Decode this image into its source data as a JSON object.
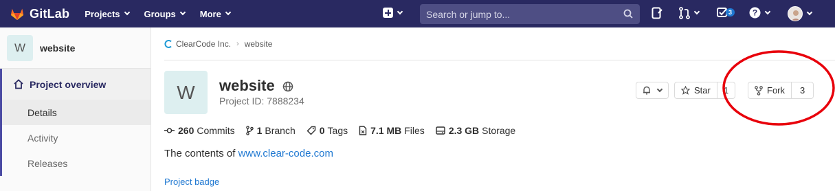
{
  "navbar": {
    "brand": "GitLab",
    "menu": [
      {
        "label": "Projects"
      },
      {
        "label": "Groups"
      },
      {
        "label": "More"
      }
    ],
    "search_placeholder": "Search or jump to...",
    "todo_count": "3",
    "icons": [
      "gitlab-logo-icon",
      "plus-icon",
      "search-icon",
      "issues-icon",
      "merge-request-icon",
      "todo-icon",
      "help-icon",
      "avatar"
    ]
  },
  "sidebar": {
    "project_initial": "W",
    "project_name": "website",
    "overview_label": "Project overview",
    "sub_items": [
      "Details",
      "Activity",
      "Releases"
    ]
  },
  "breadcrumb": {
    "group": "ClearCode Inc.",
    "project": "website"
  },
  "project": {
    "initial": "W",
    "name": "website",
    "id_text": "Project ID: 7888234",
    "star_label": "Star",
    "star_count": "1",
    "fork_label": "Fork",
    "fork_count": "3"
  },
  "stats": {
    "commits_num": "260",
    "commits_label": "Commits",
    "branch_num": "1",
    "branch_label": "Branch",
    "tags_num": "0",
    "tags_label": "Tags",
    "files_num": "7.1 MB",
    "files_label": "Files",
    "storage_num": "2.3 GB",
    "storage_label": "Storage"
  },
  "description": {
    "prefix": "The contents of ",
    "link": "www.clear-code.com"
  },
  "project_badge": "Project badge",
  "colors": {
    "navbar": "#292961",
    "link": "#1f78d1",
    "annotation": "#e8000b"
  }
}
